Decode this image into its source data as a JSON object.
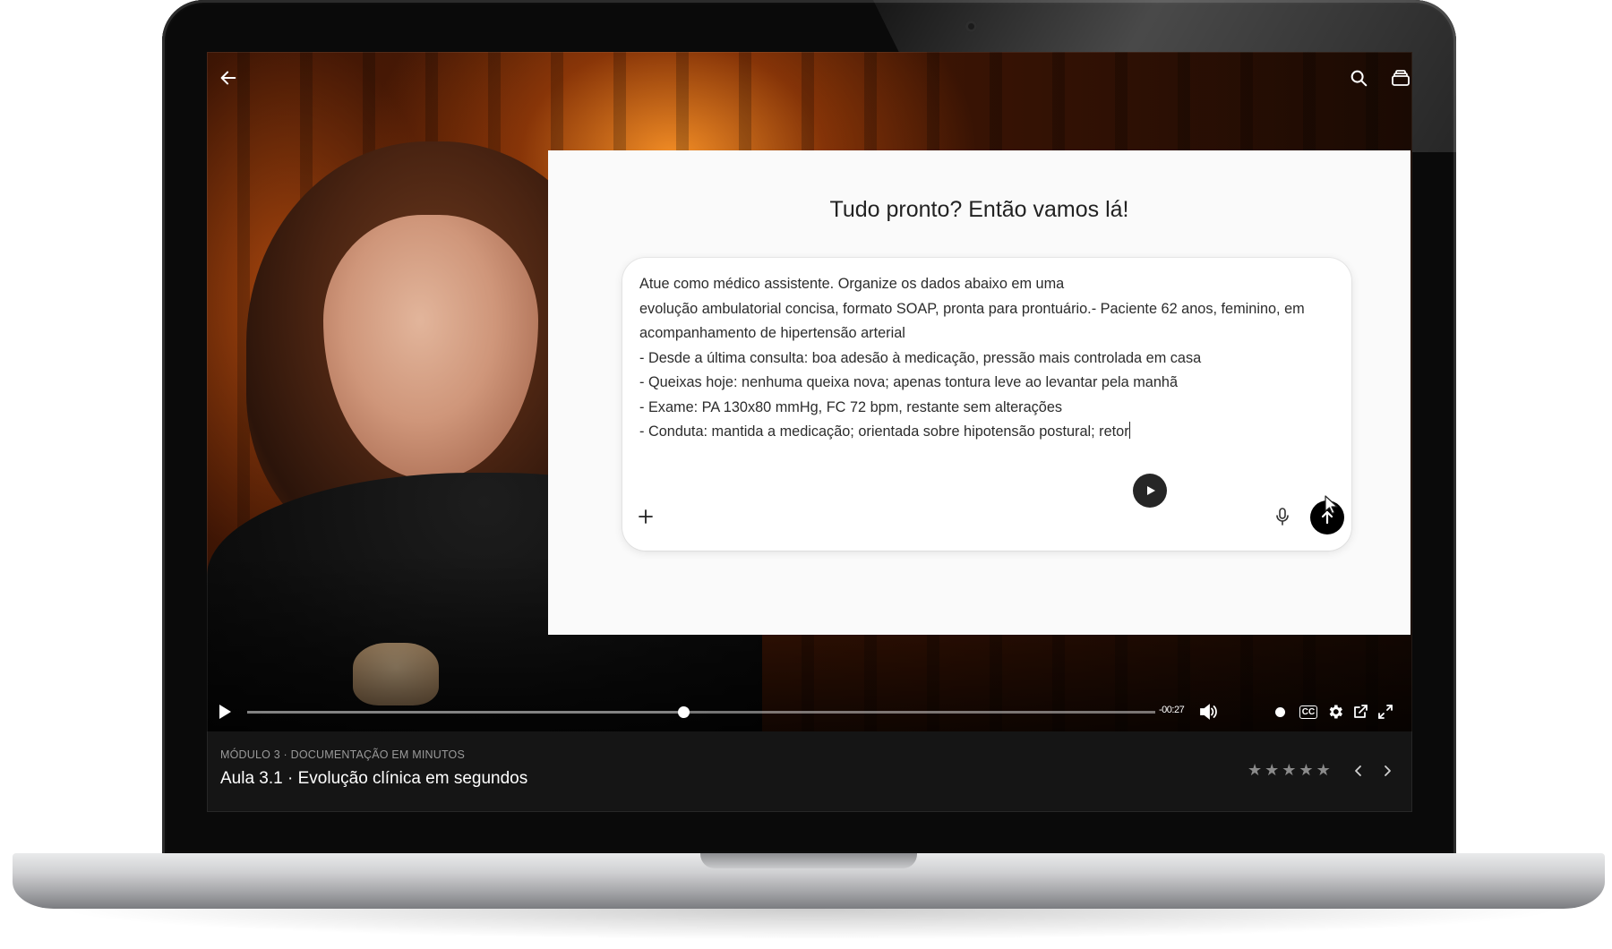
{
  "top_bar": {
    "back_icon": "arrow-left-icon",
    "search_icon": "search-icon",
    "library_icon": "stacked-layers-icon"
  },
  "overlay": {
    "title": "Tudo pronto? Então vamos lá!",
    "prompt_lines": [
      "Atue como médico assistente. Organize os dados abaixo em uma",
      "evolução ambulatorial concisa, formato SOAP, pronta para prontuário.- Paciente 62 anos, feminino, em acompanhamento de hipertensão arterial",
      "- Desde a última consulta: boa adesão à medicação, pressão mais controlada em casa",
      "- Queixas hoje: nenhuma queixa nova; apenas tontura leve ao levantar pela manhã",
      "- Exame: PA 130x80 mmHg, FC 72 bpm, restante sem alterações",
      "- Conduta: mantida a medicação; orientada sobre hipotensão postural; retor"
    ],
    "attach_icon": "plus-icon",
    "mic_icon": "microphone-icon",
    "send_icon": "arrow-up-icon"
  },
  "player": {
    "play_icon": "play-icon",
    "progress": 0.48,
    "time_remaining": "-00:27",
    "volume_icon": "volume-icon",
    "captions_label": "CC",
    "settings_icon": "gear-icon",
    "popout_icon": "external-link-icon",
    "fullscreen_icon": "fullscreen-icon"
  },
  "lesson": {
    "module": "MÓDULO 3 · DOCUMENTAÇÃO EM MINUTOS",
    "title": "Aula 3.1 · Evolução clínica em segundos",
    "rating": 0,
    "rating_max": 5,
    "prev_icon": "chevron-left-icon",
    "next_icon": "chevron-right-icon"
  }
}
